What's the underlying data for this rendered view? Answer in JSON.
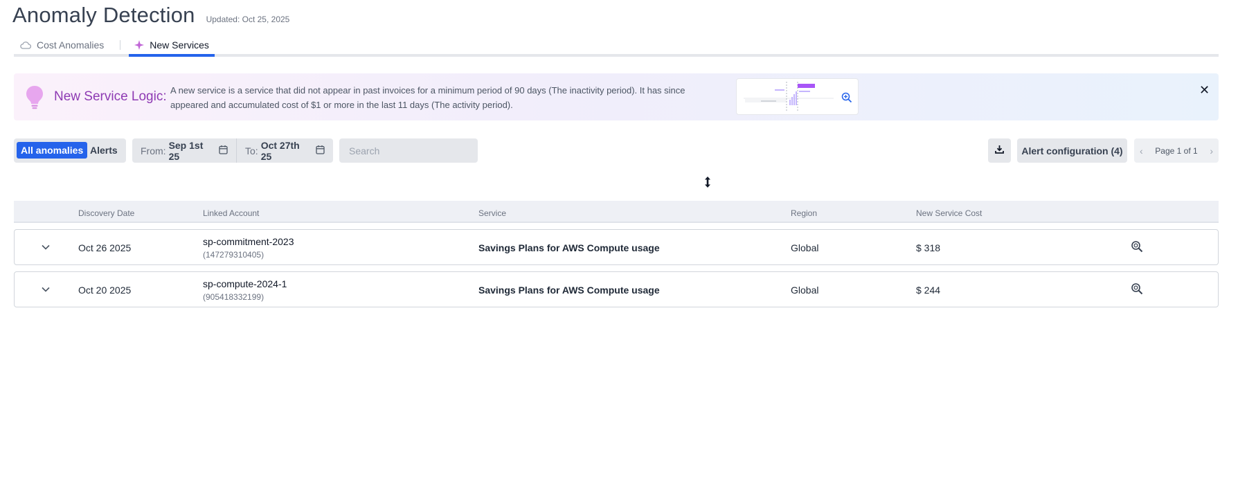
{
  "header": {
    "title": "Anomaly Detection",
    "updated": "Updated: Oct 25, 2025"
  },
  "tabs": [
    {
      "label": "Cost Anomalies",
      "icon": "cloud-icon",
      "active": false
    },
    {
      "label": "New Services",
      "icon": "sparkle-icon",
      "active": true
    }
  ],
  "banner": {
    "title": "New Service Logic:",
    "text": "A new service is a service that did not appear in past invoices for a minimum period of 90 days (The inactivity period). It has since appeared and accumulated cost of $1 or more in the last 11 days (The activity period).",
    "icon": "lightbulb-icon",
    "close": "✕"
  },
  "toolbar": {
    "all_anomalies": "All anomalies",
    "alerts": "Alerts",
    "from_label": "From:",
    "from_value": "Sep 1st 25",
    "to_label": "To:",
    "to_value": "Oct 27th 25",
    "search_placeholder": "Search",
    "alert_configuration": "Alert configuration (4)",
    "page": "Page 1 of 1",
    "prev": "‹",
    "next": "›"
  },
  "table": {
    "columns": [
      "Discovery Date",
      "Linked Account",
      "Service",
      "Region",
      "New Service Cost"
    ],
    "rows": [
      {
        "date": "Oct 26 2025",
        "account": "sp-commitment-2023",
        "account_id": "(147279310405)",
        "service": "Savings Plans for AWS Compute usage",
        "region": "Global",
        "cost": "$ 318"
      },
      {
        "date": "Oct 20 2025",
        "account": "sp-compute-2024-1",
        "account_id": "(905418332199)",
        "service": "Savings Plans for AWS Compute usage",
        "region": "Global",
        "cost": "$ 244"
      }
    ]
  },
  "colors": {
    "accent": "#2563eb",
    "banner_title": "#8e3ab3",
    "sparkle": "#c065d6"
  }
}
